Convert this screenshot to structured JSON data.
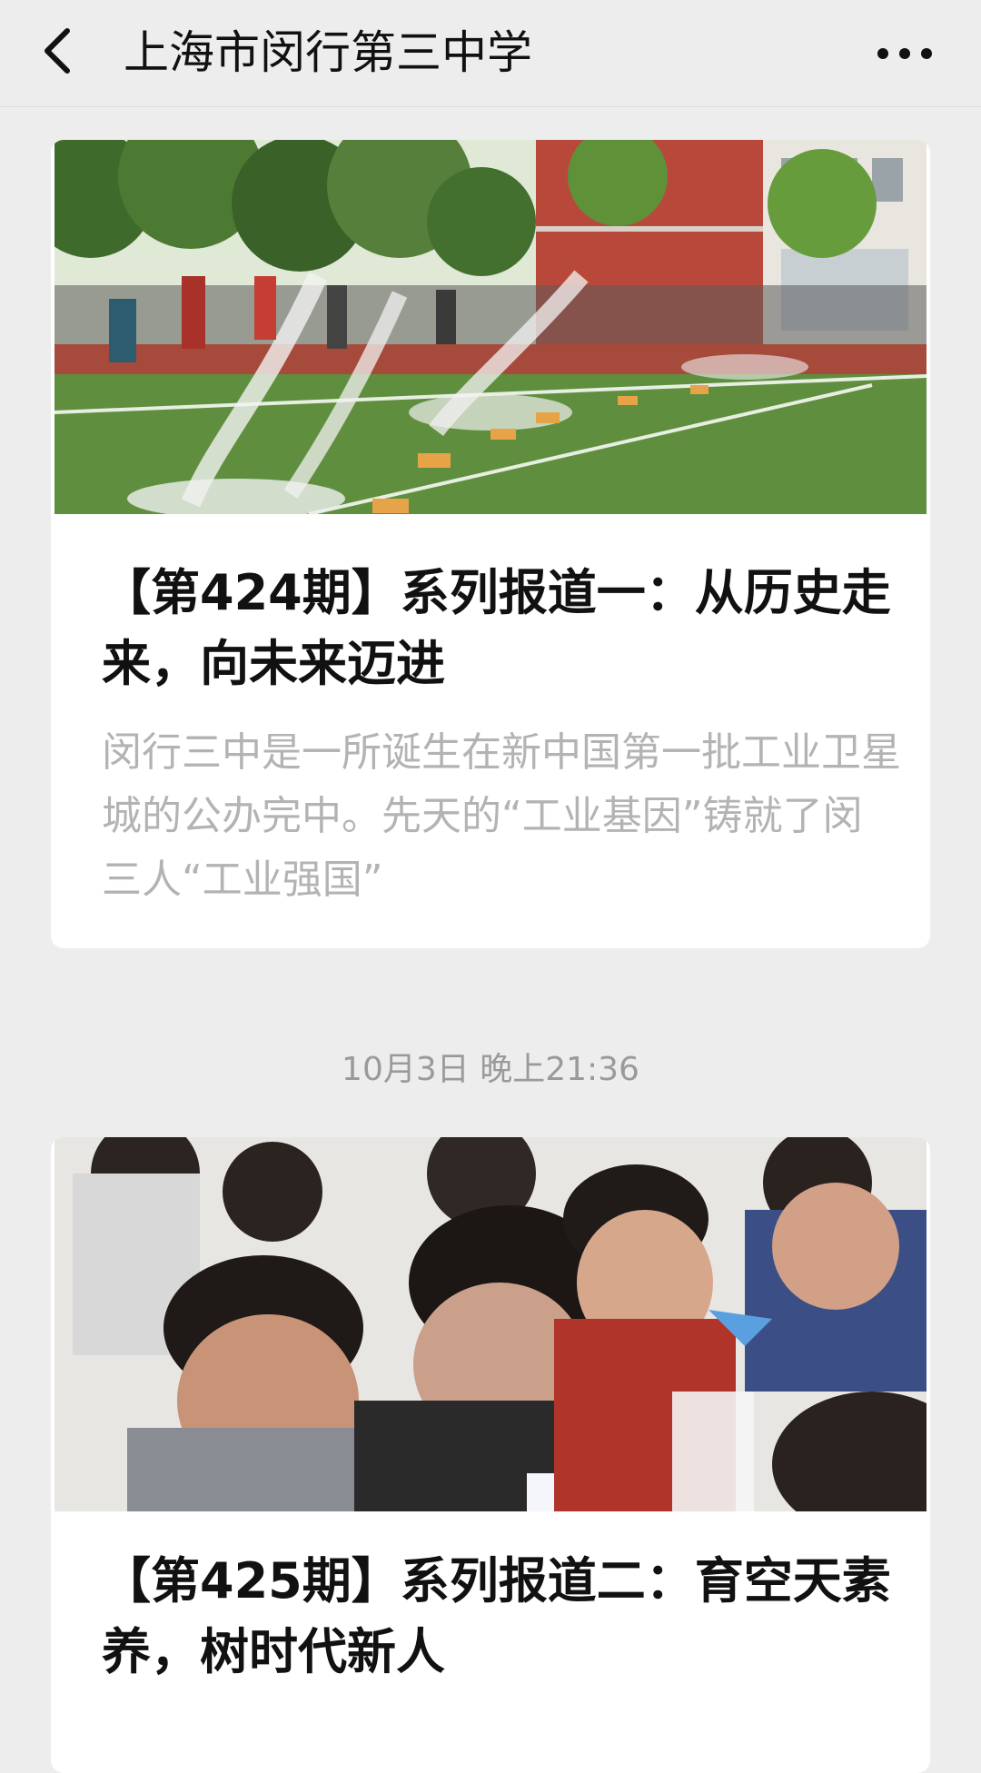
{
  "header": {
    "back_icon": "chevron-left-icon",
    "title": "上海市闵行第三中学",
    "more_icon": "more-horizontal-icon"
  },
  "messages": [
    {
      "image": "student-rocket-launch-on-sports-field",
      "title": "【第424期】系列报道一：从历史走来，向未来迈进",
      "summary": "闵行三中是一所诞生在新中国第一批工业卫星城的公办完中。先天的“工业基因”铸就了闵三人“工业强国”"
    },
    {
      "timestamp": "10月3日 晚上21:36",
      "image": "students-assembling-paper-rockets-in-classroom",
      "title": "【第425期】系列报道二：育空天素养，树时代新人"
    }
  ]
}
